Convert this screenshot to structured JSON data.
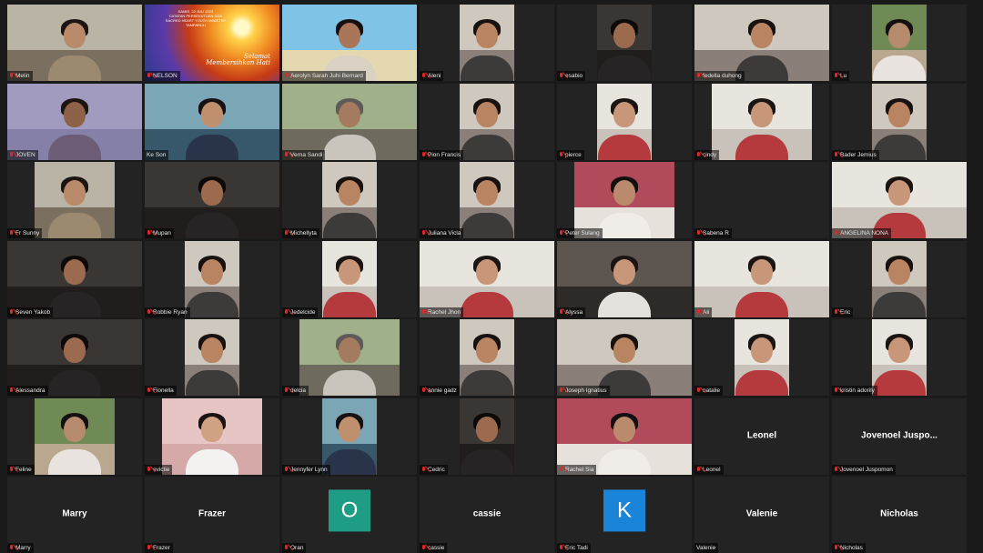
{
  "colors": {
    "background": "#1a1a1a",
    "tile": "#232323",
    "active_speaker": "#d4d22a",
    "muted": "#e02828"
  },
  "slide": {
    "lines": [
      "KAMIS, 22 JULI 2023",
      "CATATAN PERSEKUTUAN DOA",
      "SACRED HEART YOUTH MINISTRY",
      "TAMPARULI"
    ],
    "script_lines": [
      "Selamat",
      "Membersihkan Hati"
    ]
  },
  "participants": [
    {
      "name": "Melin",
      "kind": "video",
      "muted": true,
      "scene": "office"
    },
    {
      "name": "NELSON",
      "kind": "slide",
      "muted": true
    },
    {
      "name": "Aerolyn Sarah Juhi Bernard",
      "kind": "video",
      "muted": true,
      "scene": "beach"
    },
    {
      "name": "Aleni",
      "kind": "video",
      "muted": true,
      "scene": "room"
    },
    {
      "name": "esabio",
      "kind": "video",
      "muted": true,
      "scene": "dark"
    },
    {
      "name": "fedella duhong",
      "kind": "video",
      "muted": true,
      "scene": "room"
    },
    {
      "name": "Lu",
      "kind": "video",
      "muted": true,
      "scene": "garden"
    },
    {
      "name": "JOVEN",
      "kind": "video",
      "muted": true,
      "scene": "purple"
    },
    {
      "name": "Ke Son",
      "kind": "video",
      "muted": false,
      "scene": "blue",
      "active": true
    },
    {
      "name": "Verna Sandi",
      "kind": "video",
      "muted": true,
      "scene": "outdoor"
    },
    {
      "name": "Pion Francis",
      "kind": "video",
      "muted": true,
      "scene": "room"
    },
    {
      "name": "pierce",
      "kind": "video",
      "muted": true,
      "scene": "light"
    },
    {
      "name": "cindy",
      "kind": "video",
      "muted": true,
      "scene": "light"
    },
    {
      "name": "Bader Jemius",
      "kind": "video",
      "muted": true,
      "scene": "room"
    },
    {
      "name": "Fr Sunny",
      "kind": "video",
      "muted": true,
      "scene": "office"
    },
    {
      "name": "Mupan",
      "kind": "video",
      "muted": true,
      "scene": "dark"
    },
    {
      "name": "Michellyta",
      "kind": "video",
      "muted": true,
      "scene": "room"
    },
    {
      "name": "Juliana Vicla",
      "kind": "video",
      "muted": true,
      "scene": "room"
    },
    {
      "name": "Peter Sulang",
      "kind": "video",
      "muted": true,
      "scene": "curtain"
    },
    {
      "name": "Sabena R",
      "kind": "blank",
      "muted": true
    },
    {
      "name": "ANGELINA NONA",
      "kind": "video",
      "muted": true,
      "scene": "light"
    },
    {
      "name": "Seven Yakob",
      "kind": "video",
      "muted": true,
      "scene": "dark"
    },
    {
      "name": "Robbie Ryan",
      "kind": "video",
      "muted": true,
      "scene": "room"
    },
    {
      "name": "Jedelcide",
      "kind": "video",
      "muted": true,
      "scene": "light"
    },
    {
      "name": "Rachel Jhon",
      "kind": "video",
      "muted": true,
      "scene": "light"
    },
    {
      "name": "Alyssa",
      "kind": "video",
      "muted": true,
      "scene": "car"
    },
    {
      "name": "Ali",
      "kind": "video",
      "muted": true,
      "scene": "light"
    },
    {
      "name": "Eric",
      "kind": "video",
      "muted": true,
      "scene": "room"
    },
    {
      "name": "Alessandra",
      "kind": "video",
      "muted": true,
      "scene": "dark"
    },
    {
      "name": "Fionella",
      "kind": "video",
      "muted": true,
      "scene": "room"
    },
    {
      "name": "delcia",
      "kind": "video",
      "muted": true,
      "scene": "outdoor"
    },
    {
      "name": "annie gadz",
      "kind": "video",
      "muted": true,
      "scene": "room"
    },
    {
      "name": "Joseph Ignatius",
      "kind": "video",
      "muted": true,
      "scene": "room"
    },
    {
      "name": "natalie",
      "kind": "video",
      "muted": true,
      "scene": "light"
    },
    {
      "name": "kristin adorily",
      "kind": "video",
      "muted": true,
      "scene": "light"
    },
    {
      "name": "Feline",
      "kind": "video",
      "muted": true,
      "scene": "garden"
    },
    {
      "name": "evictie",
      "kind": "video",
      "muted": true,
      "scene": "pink"
    },
    {
      "name": "Jennyfer Lynn",
      "kind": "video",
      "muted": true,
      "scene": "blue"
    },
    {
      "name": "Cedric",
      "kind": "video",
      "muted": true,
      "scene": "dark"
    },
    {
      "name": "Rachel Sia",
      "kind": "video",
      "muted": true,
      "scene": "curtain"
    },
    {
      "name": "Leonel",
      "kind": "name",
      "muted": true,
      "display": "Leonel"
    },
    {
      "name": "Jovenoel Juspomon",
      "kind": "name",
      "muted": true,
      "display": "Jovenoel  Juspo..."
    },
    {
      "name": "Marry",
      "kind": "name",
      "muted": true,
      "display": "Marry"
    },
    {
      "name": "Frazer",
      "kind": "name",
      "muted": true,
      "display": "Frazer"
    },
    {
      "name": "Oran",
      "kind": "avatar",
      "muted": true,
      "initial": "O",
      "avatar_color": "#1f9c84"
    },
    {
      "name": "cassie",
      "kind": "name",
      "muted": true,
      "display": "cassie"
    },
    {
      "name": "Eric Tadi",
      "kind": "avatar",
      "muted": true,
      "initial": "K",
      "avatar_color": "#1a84d8"
    },
    {
      "name": "Valenie",
      "kind": "name",
      "muted": false,
      "display": "Valenie"
    },
    {
      "name": "Nicholas",
      "kind": "name",
      "muted": true,
      "display": "Nicholas"
    }
  ]
}
